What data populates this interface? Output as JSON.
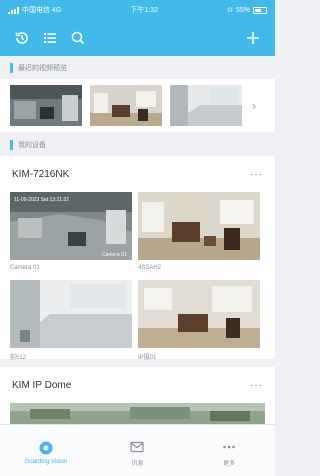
{
  "colors": {
    "accent": "#41b9ea",
    "background": "#eef0f3"
  },
  "statusbar": {
    "carrier": "中国电信 4G",
    "time": "下午1:32",
    "battery": "55%"
  },
  "toolbar": {
    "icons": [
      "history-icon",
      "list-icon",
      "search-icon",
      "add-icon"
    ]
  },
  "sections": {
    "recent": "最近的视频预览",
    "my_devices": "我的设备"
  },
  "devices": [
    {
      "name": "KIM-7216NK",
      "more": "···",
      "cameras": [
        {
          "label": "Camera 01",
          "overlay": "11-09-2023 Sat 13:21:32",
          "tag": "Camera 01"
        },
        {
          "label": "4SSAH2"
        },
        {
          "label": "前512"
        },
        {
          "label": "IP摄01"
        }
      ]
    },
    {
      "name": "KIM IP Dome",
      "more": "···"
    }
  ],
  "tabs": [
    {
      "label": "Guarding Vision",
      "icon": "camera-tab-icon",
      "active": true
    },
    {
      "label": "讯息",
      "icon": "message-icon",
      "active": false
    },
    {
      "label": "更多",
      "icon": "more-icon",
      "active": false
    }
  ]
}
